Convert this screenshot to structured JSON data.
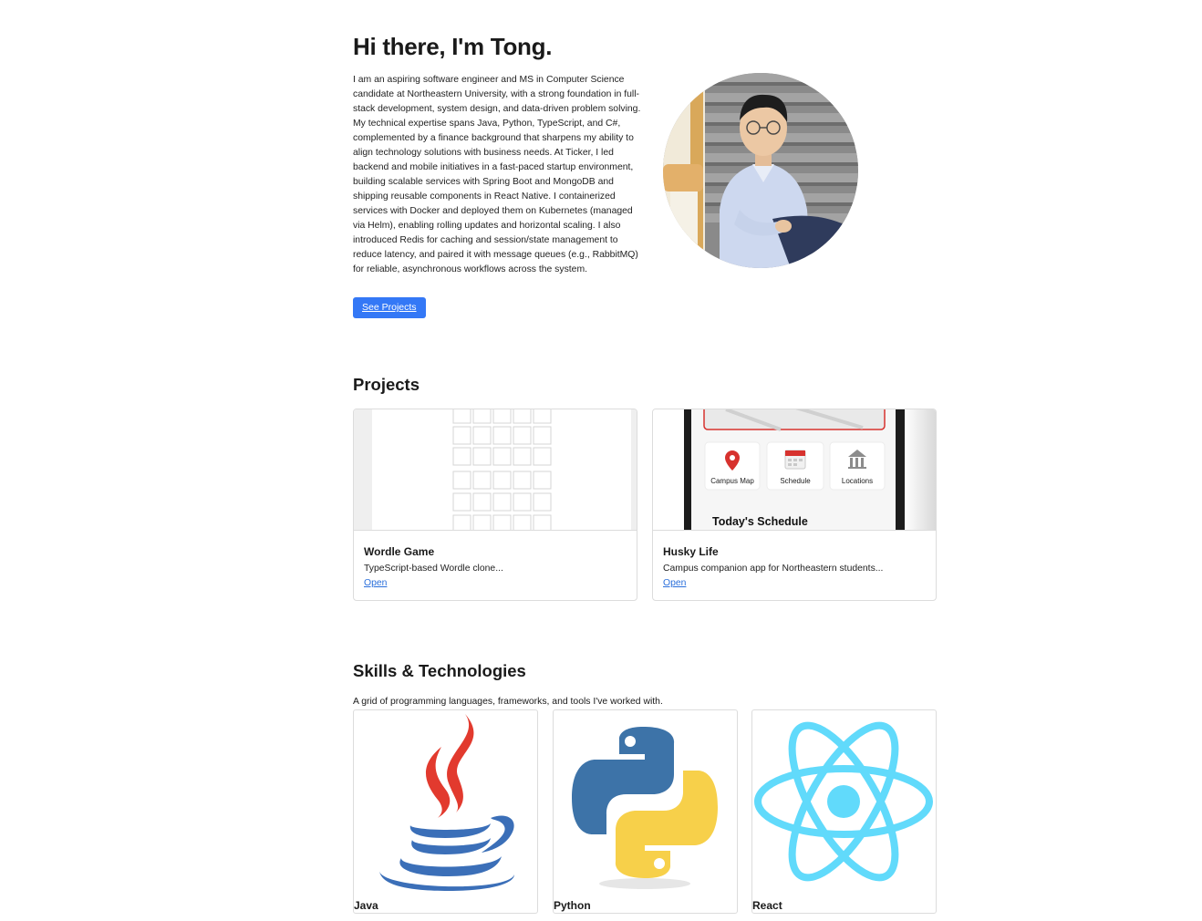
{
  "hero": {
    "title": "Hi there, I'm Tong.",
    "bio": "I am an aspiring software engineer and MS in Computer Science candidate at Northeastern University, with a strong foundation in full-stack development, system design, and data-driven problem solving. My technical expertise spans Java, Python, TypeScript, and C#, complemented by a finance background that sharpens my ability to align technology solutions with business needs. At Ticker, I led backend and mobile initiatives in a fast-paced startup environment, building scalable services with Spring Boot and MongoDB and shipping reusable components in React Native. I containerized services with Docker and deployed them on Kubernetes (managed via Helm), enabling rolling updates and horizontal scaling. I also introduced Redis for caching and session/state management to reduce latency, and paired it with message queues (e.g., RabbitMQ) for reliable, asynchronous workflows across the system.",
    "cta_label": "See Projects"
  },
  "projects": {
    "title": "Projects",
    "items": [
      {
        "name": "Wordle Game",
        "description": "TypeScript-based Wordle clone...",
        "link_label": "Open"
      },
      {
        "name": "Husky Life",
        "description": "Campus companion app for Northeastern students...",
        "link_label": "Open",
        "screenshot": {
          "tiles": [
            "Campus Map",
            "Schedule",
            "Locations"
          ],
          "heading": "Today's Schedule"
        }
      }
    ]
  },
  "skills": {
    "title": "Skills & Technologies",
    "description": "A grid of programming languages, frameworks, and tools I've worked with.",
    "items": [
      {
        "name": "Java",
        "icon": "java-icon"
      },
      {
        "name": "Python",
        "icon": "python-icon"
      },
      {
        "name": "React",
        "icon": "react-icon"
      }
    ]
  },
  "colors": {
    "accent": "#3478f6",
    "link": "#2a6fdb",
    "husky_red": "#d7322e",
    "react_blue": "#61dafb",
    "python_blue": "#3d73a8",
    "python_yellow": "#f7d04a",
    "java_red": "#e23a2e",
    "java_blue": "#3b6fb8"
  }
}
